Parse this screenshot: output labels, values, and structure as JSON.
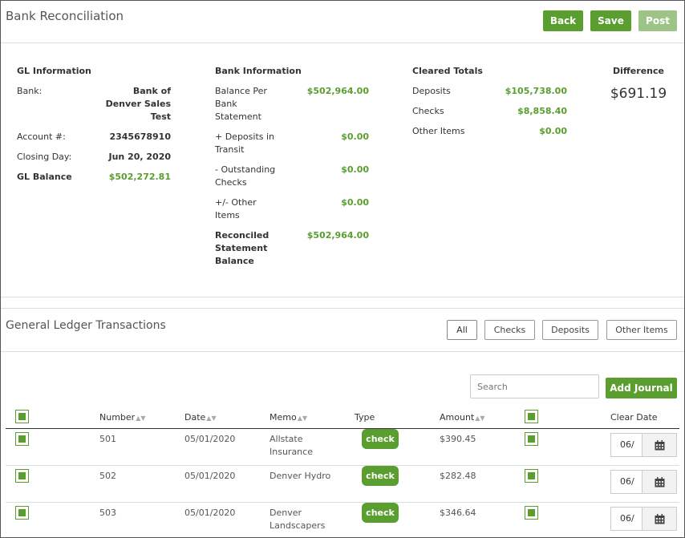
{
  "header": {
    "title": "Bank Reconciliation",
    "back_label": "Back",
    "save_label": "Save",
    "post_label": "Post"
  },
  "gl_info": {
    "heading": "GL Information",
    "bank_label": "Bank:",
    "bank_line1": "Bank of",
    "bank_line2": "Denver Sales",
    "bank_line3": "Test",
    "account_label": "Account #:",
    "account_value": "2345678910",
    "closing_label": "Closing Day:",
    "closing_value": "Jun 20, 2020",
    "balance_label": "GL Balance",
    "balance_value": "$502,272.81"
  },
  "bank_info": {
    "heading": "Bank Information",
    "bps_l1": "Balance Per",
    "bps_l2": "Bank",
    "bps_l3": "Statement",
    "bps_value": "$502,964.00",
    "dit_l1": "+ Deposits in",
    "dit_l2": "Transit",
    "dit_value": "$0.00",
    "oc_l1": "- Outstanding",
    "oc_l2": "Checks",
    "oc_value": "$0.00",
    "oi_l1": "+/- Other",
    "oi_l2": "Items",
    "oi_value": "$0.00",
    "rsb_l1": "Reconciled",
    "rsb_l2": "Statement",
    "rsb_l3": "Balance",
    "rsb_value": "$502,964.00"
  },
  "cleared": {
    "heading": "Cleared Totals",
    "deposits_label": "Deposits",
    "deposits_value": "$105,738.00",
    "checks_label": "Checks",
    "checks_value": "$8,858.40",
    "other_label": "Other Items",
    "other_value": "$0.00"
  },
  "difference": {
    "heading": "Difference",
    "value": "$691.19"
  },
  "gl_transactions": {
    "title": "General Ledger Transactions",
    "filters": [
      "All",
      "Checks",
      "Deposits",
      "Other Items"
    ],
    "search_placeholder": "Search",
    "add_journal_label": "Add Journal",
    "columns": {
      "number": "Number",
      "date": "Date",
      "memo": "Memo",
      "type": "Type",
      "amount": "Amount",
      "clear_date": "Clear Date"
    },
    "rows": [
      {
        "number": "501",
        "date": "05/01/2020",
        "memo_l1": "Allstate",
        "memo_l2": "Insurance",
        "type": "check",
        "amount": "$390.45",
        "clear_date": "06/"
      },
      {
        "number": "502",
        "date": "05/01/2020",
        "memo_l1": "Denver Hydro",
        "memo_l2": "",
        "type": "check",
        "amount": "$282.48",
        "clear_date": "06/"
      },
      {
        "number": "503",
        "date": "05/01/2020",
        "memo_l1": "Denver",
        "memo_l2": "Landscapers",
        "type": "check",
        "amount": "$346.64",
        "clear_date": "06/"
      }
    ]
  },
  "icons": {
    "calendar": "calendar-icon",
    "sort": "sort-icon",
    "checkbox": "checkbox-icon"
  },
  "colors": {
    "accent": "#5a9e2f",
    "accent_disabled": "#9bc486",
    "value_green": "#5a9e2f"
  }
}
